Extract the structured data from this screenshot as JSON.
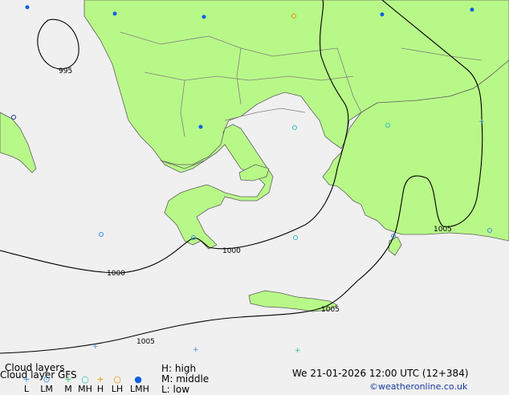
{
  "title_line1": "Cloud layers",
  "title_line2": "Cloud layer GFS",
  "legend": {
    "codes": [
      "L",
      "LM",
      "M",
      "MH",
      "H",
      "LH",
      "LMH"
    ],
    "symbols": [
      "+",
      "⊙",
      "+",
      "○",
      "+",
      "○",
      "●"
    ],
    "symbol_colors": [
      "#3a8de0",
      "#3a8de0",
      "#30c070",
      "#30c0c0",
      "#e0a000",
      "#e09000",
      "#1060e0"
    ],
    "key_high": "H: high",
    "key_middle": "M: middle",
    "key_low": "L: low"
  },
  "valid_time": "We 21-01-2026 12:00 UTC (12+384)",
  "credit": "©weatheronline.co.uk",
  "isobars": [
    {
      "label": "995"
    },
    {
      "label": "1000"
    },
    {
      "label": "1000"
    },
    {
      "label": "1005"
    },
    {
      "label": "1005"
    },
    {
      "label": "1005"
    }
  ],
  "colors": {
    "sea": "#f0f0f0",
    "land": "#b8f888",
    "border": "#808080",
    "coast": "#606060",
    "isobar": "#000000",
    "credit": "#1a3aa0"
  }
}
